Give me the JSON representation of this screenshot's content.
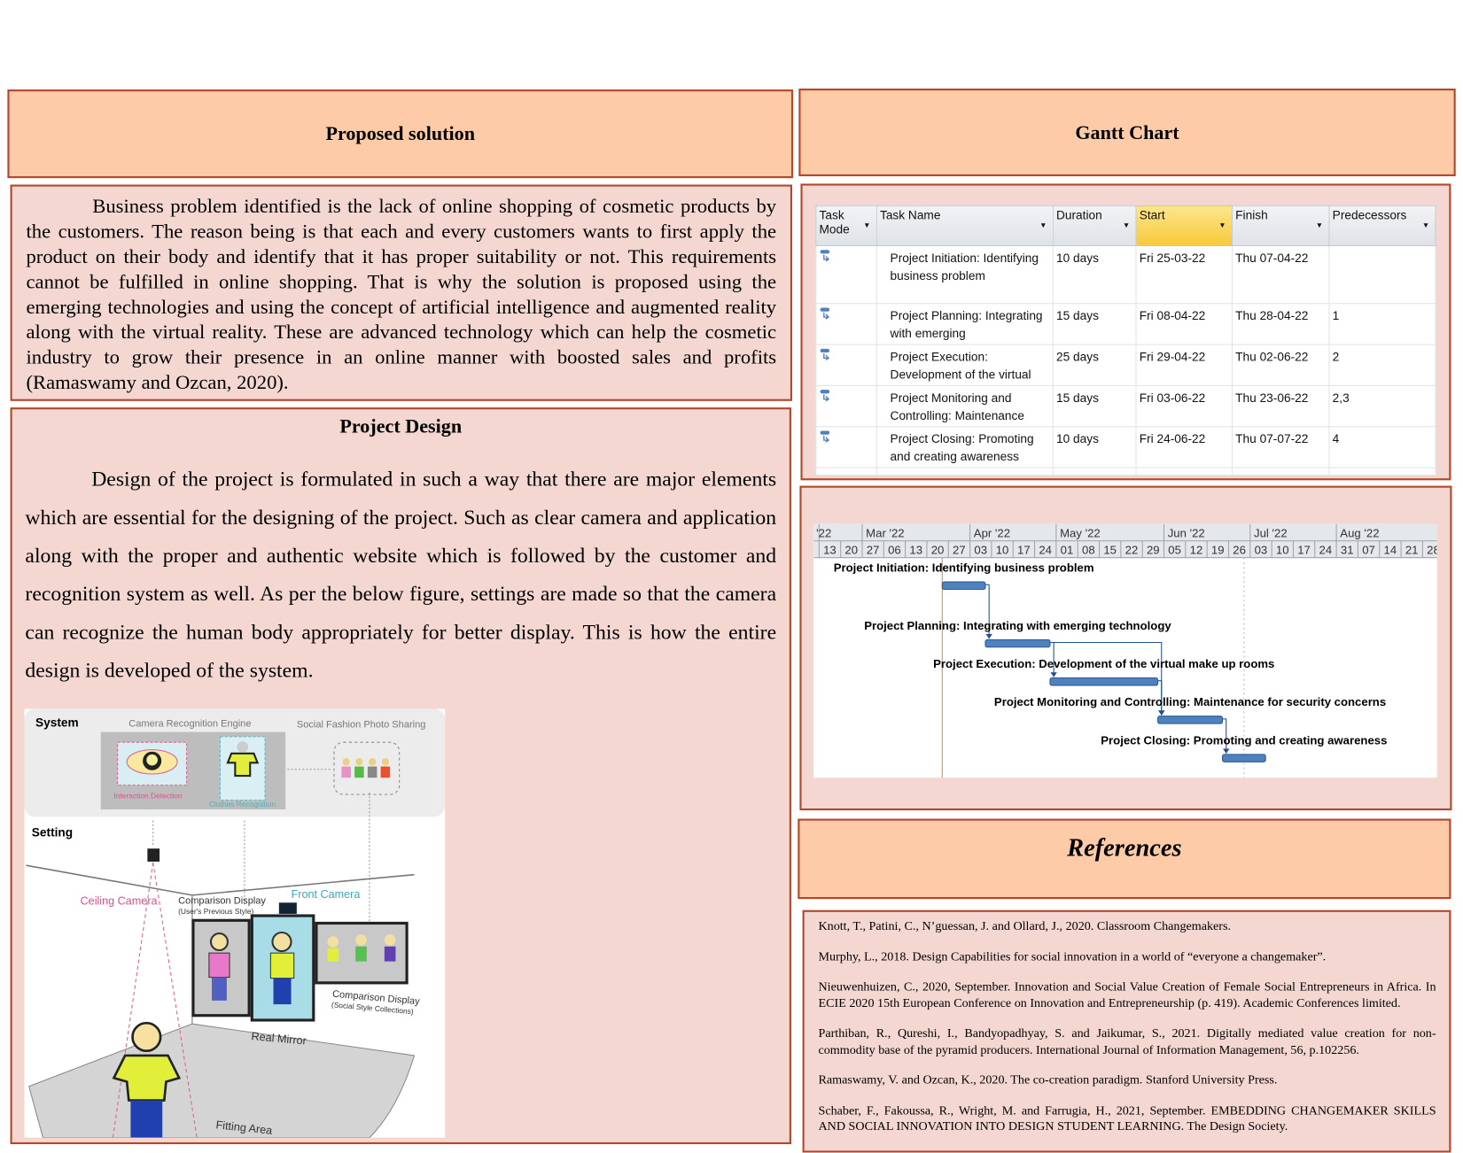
{
  "proposed": {
    "title": "Proposed solution",
    "body": "Business problem identified is the lack of online shopping of cosmetic products by the customers. The reason being is that each and every customers wants to first apply the product on their body and identify that it has proper suitability or not. This requirements cannot be fulfilled in online shopping. That is why the solution is proposed using the emerging technologies and using the concept of artificial intelligence and augmented reality along with the virtual reality. These are advanced technology which can help the cosmetic industry to grow their presence in an online manner with boosted sales and profits (Ramaswamy and Ozcan, 2020)."
  },
  "design": {
    "title": "Project Design",
    "body": "Design of the project is formulated in such a way that there are major elements which are essential for the designing of the project. Such as clear camera and application along with the proper and authentic website which is followed by the customer and recognition system as well. As per the below figure, settings are made so that the camera can recognize the human body appropriately for better display. This is how the entire design is developed of the system.",
    "figure": {
      "system": "System",
      "engine": "Camera Recognition Engine",
      "sharing": "Social Fashion Photo Sharing",
      "interaction": "Interaction Detection",
      "clothes": "Clothes Recognition",
      "setting": "Setting",
      "ceiling_camera": "Ceiling Camera",
      "comparison_prev": "Comparison Display",
      "comparison_prev_sub": "(User's Previous Style)",
      "front_camera": "Front Camera",
      "comparison_social": "Comparison Display",
      "comparison_social_sub": "(Social Style Collections)",
      "real_mirror": "Real Mirror",
      "fitting_area": "Fitting Area"
    }
  },
  "gantt": {
    "title": "Gantt Chart",
    "columns": [
      "Task Mode",
      "Task Name",
      "Duration",
      "Start",
      "Finish",
      "Predecessors"
    ],
    "selected_column": "Start",
    "rows": [
      {
        "name": "Project Initiation: Identifying business problem",
        "duration": "10 days",
        "start": "Fri 25-03-22",
        "finish": "Thu 07-04-22",
        "pred": ""
      },
      {
        "name": "Project Planning: Integrating with emerging",
        "duration": "15 days",
        "start": "Fri 08-04-22",
        "finish": "Thu 28-04-22",
        "pred": "1"
      },
      {
        "name": "Project Execution: Development of the virtual",
        "duration": "25 days",
        "start": "Fri 29-04-22",
        "finish": "Thu 02-06-22",
        "pred": "2"
      },
      {
        "name": "Project Monitoring and Controlling: Maintenance",
        "duration": "15 days",
        "start": "Fri 03-06-22",
        "finish": "Thu 23-06-22",
        "pred": "2,3"
      },
      {
        "name": "Project Closing: Promoting and creating awareness",
        "duration": "10 days",
        "start": "Fri 24-06-22",
        "finish": "Thu 07-07-22",
        "pred": "4"
      }
    ]
  },
  "chart_data": {
    "type": "gantt",
    "months": [
      "'22",
      "Mar '22",
      "Apr '22",
      "May '22",
      "Jun '22",
      "Jul '22",
      "Aug '22"
    ],
    "weeks": [
      "13",
      "20",
      "27",
      "06",
      "13",
      "20",
      "27",
      "03",
      "10",
      "17",
      "24",
      "01",
      "08",
      "15",
      "22",
      "29",
      "05",
      "12",
      "19",
      "26",
      "03",
      "10",
      "17",
      "24",
      "31",
      "07",
      "14",
      "21",
      "28"
    ],
    "tasks": [
      {
        "label": "Project Initiation: Identifying business problem",
        "start": "2022-03-25",
        "finish": "2022-04-07"
      },
      {
        "label": "Project Planning: Integrating with emerging technology",
        "start": "2022-04-08",
        "finish": "2022-04-28"
      },
      {
        "label": "Project Execution: Development of the virtual make up rooms",
        "start": "2022-04-29",
        "finish": "2022-06-02"
      },
      {
        "label": "Project Monitoring and Controlling: Maintenance for security concerns",
        "start": "2022-06-03",
        "finish": "2022-06-23"
      },
      {
        "label": "Project Closing: Promoting and creating awareness",
        "start": "2022-06-24",
        "finish": "2022-07-07"
      }
    ],
    "dependencies": [
      [
        0,
        1
      ],
      [
        1,
        2
      ],
      [
        1,
        3
      ],
      [
        2,
        3
      ],
      [
        3,
        4
      ]
    ],
    "today": "2022-03-25",
    "bar_color": "#4f81bd"
  },
  "references": {
    "title": "References",
    "items": [
      "Knott, T., Patini, C., N’guessan, J. and Ollard, J., 2020. Classroom Changemakers.",
      "Murphy, L., 2018. Design Capabilities for social innovation in a world of “everyone a changemaker”.",
      "Nieuwenhuizen, C., 2020, September. Innovation and Social Value Creation of Female Social Entrepreneurs in Africa. In ECIE 2020 15th European Conference on Innovation and Entrepreneurship (p. 419). Academic Conferences limited.",
      "Parthiban, R., Qureshi, I., Bandyopadhyay, S. and Jaikumar, S., 2021. Digitally mediated value creation for non-commodity base of the pyramid producers. International Journal of Information Management, 56, p.102256.",
      "Ramaswamy, V. and Ozcan, K., 2020. The co-creation paradigm. Stanford University Press.",
      "Schaber, F., Fakoussa, R., Wright, M. and Farrugia, H., 2021, September. EMBEDDING CHANGEMAKER SKILLS AND SOCIAL INNOVATION INTO DESIGN STUDENT LEARNING. The Design Society."
    ]
  },
  "colors": {
    "header_fill": "#fdcba7",
    "body_fill": "#f3d7d0",
    "border": "#b5462a"
  }
}
